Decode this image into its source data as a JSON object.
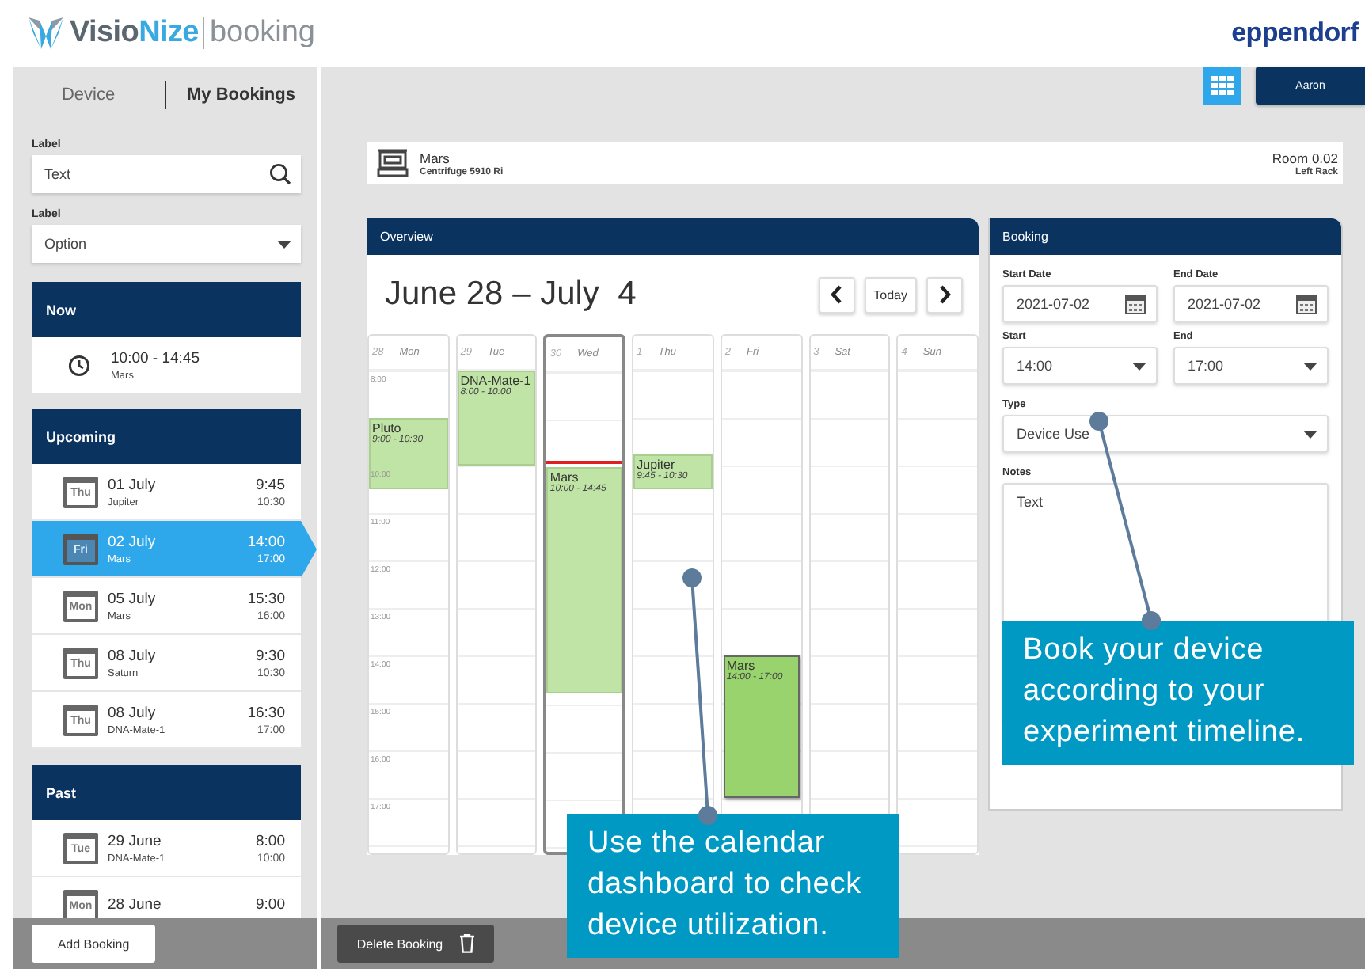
{
  "header": {
    "brand_part_1": "Visio",
    "brand_part_2": "Nize",
    "product": "booking",
    "partner_logo": "eppendorf"
  },
  "sidebar": {
    "tabs": [
      {
        "label": "Device",
        "selected": false
      },
      {
        "label": "My Bookings",
        "selected": true
      }
    ],
    "search": {
      "label": "Label",
      "value": "Text"
    },
    "filter": {
      "label": "Label",
      "value": "Option"
    },
    "sections": [
      {
        "title": "Now",
        "kind": "now",
        "items": [
          {
            "time": "10:00 - 14:45",
            "device": "Mars"
          }
        ]
      },
      {
        "title": "Upcoming",
        "kind": "list",
        "items": [
          {
            "weekday": "Thu",
            "date": "01 July",
            "device": "Jupiter",
            "start": "9:45",
            "end": "10:30",
            "selected": false
          },
          {
            "weekday": "Fri",
            "date": "02 July",
            "device": "Mars",
            "start": "14:00",
            "end": "17:00",
            "selected": true
          },
          {
            "weekday": "Mon",
            "date": "05 July",
            "device": "Mars",
            "start": "15:30",
            "end": "16:00",
            "selected": false
          },
          {
            "weekday": "Thu",
            "date": "08 July",
            "device": "Saturn",
            "start": "9:30",
            "end": "10:30",
            "selected": false
          },
          {
            "weekday": "Thu",
            "date": "08 July",
            "device": "DNA-Mate-1",
            "start": "16:30",
            "end": "17:00",
            "selected": false
          }
        ]
      },
      {
        "title": "Past",
        "kind": "list",
        "items": [
          {
            "weekday": "Tue",
            "date": "29 June",
            "device": "DNA-Mate-1",
            "start": "8:00",
            "end": "10:00",
            "selected": false
          },
          {
            "weekday": "Mon",
            "date": "28 June",
            "start": "9:00",
            "selected": false
          }
        ]
      }
    ],
    "add_button": "Add Booking"
  },
  "toolbar": {
    "user": "Aaron"
  },
  "device": {
    "name": "Mars",
    "model": "Centrifuge 5910 Ri",
    "room": "Room 0.02",
    "location": "Left Rack"
  },
  "overview": {
    "title": "Overview",
    "range": "June 28 – July  4",
    "today_button": "Today",
    "hours": [
      "8:00",
      "10:00",
      "11:00",
      "12:00",
      "13:00",
      "14:00",
      "15:00",
      "16:00",
      "17:00"
    ],
    "now_indicator": {
      "level": 0.19
    },
    "days": [
      {
        "number": "28",
        "name": "Mon",
        "today": false,
        "events": [
          {
            "title": "Pluto",
            "time": "9:00 - 10:30",
            "selected": false
          }
        ]
      },
      {
        "number": "29",
        "name": "Tue",
        "today": false,
        "events": [
          {
            "title": "DNA-Mate-1",
            "time": "8:00 - 10:00",
            "selected": false
          }
        ]
      },
      {
        "number": "30",
        "name": "Wed",
        "today": true,
        "events": [
          {
            "title": "Mars",
            "time": "10:00 - 14:45",
            "selected": false
          }
        ]
      },
      {
        "number": "1",
        "name": "Thu",
        "today": false,
        "events": [
          {
            "title": "Jupiter",
            "time": "9:45 - 10:30",
            "selected": false
          }
        ]
      },
      {
        "number": "2",
        "name": "Fri",
        "today": false,
        "events": [
          {
            "title": "Mars",
            "time": "14:00 - 17:00",
            "selected": true
          }
        ]
      },
      {
        "number": "3",
        "name": "Sat",
        "today": false
      },
      {
        "number": "4",
        "name": "Sun",
        "today": false
      }
    ]
  },
  "booking": {
    "title": "Booking",
    "start_date": {
      "label": "Start Date",
      "value": "2021-07-02"
    },
    "end_date": {
      "label": "End Date",
      "value": "2021-07-02"
    },
    "start": {
      "label": "Start",
      "value": "14:00"
    },
    "end": {
      "label": "End",
      "value": "17:00"
    },
    "type": {
      "label": "Type",
      "value": "Device Use"
    },
    "notes": {
      "label": "Notes",
      "value": "Text"
    }
  },
  "footer": {
    "delete_button": "Delete Booking"
  },
  "callouts": [
    {
      "text": "Use the calendar dashboard to check device utilization."
    },
    {
      "text": "Book your device according to your experiment timeline."
    }
  ]
}
